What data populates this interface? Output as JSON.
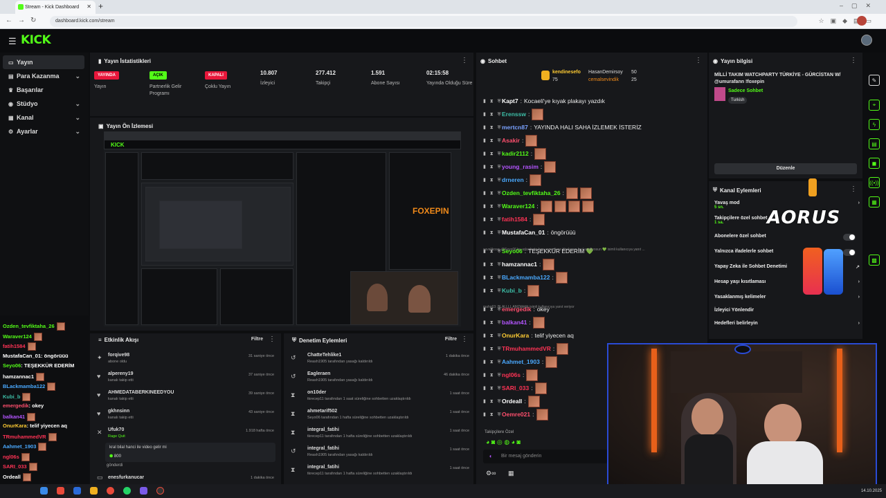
{
  "browser": {
    "tab_title": "Stream - Kick Dashboard",
    "url": "dashboard.kick.com/stream"
  },
  "header": {
    "logo": "KICK"
  },
  "sidebar": {
    "items": [
      {
        "label": "Yayın",
        "icon": "broadcast-icon",
        "active": true
      },
      {
        "label": "Para Kazanma",
        "icon": "money-icon",
        "chevron": true
      },
      {
        "label": "Başarılar",
        "icon": "trophy-icon"
      },
      {
        "label": "Stüdyo",
        "icon": "studio-icon",
        "chevron": true
      },
      {
        "label": "Kanal",
        "icon": "channel-icon",
        "chevron": true
      },
      {
        "label": "Ayarlar",
        "icon": "gear-icon",
        "chevron": true
      }
    ]
  },
  "stats": {
    "title": "Yayın İstatistikleri",
    "items": [
      {
        "value": "YAYINDA",
        "label": "Yayın",
        "kind": "badge-red"
      },
      {
        "value": "AÇIK",
        "label": "Partnerlik Gelir Programı",
        "kind": "badge-green"
      },
      {
        "value": "KAPALI",
        "label": "Çoklu Yayın",
        "kind": "badge-red"
      },
      {
        "value": "10.807",
        "label": "İzleyici"
      },
      {
        "value": "277.412",
        "label": "Takipçi"
      },
      {
        "value": "1.591",
        "label": "Abone Sayısı"
      },
      {
        "value": "02:15:58",
        "label": "Yayında Olduğu Süre"
      }
    ]
  },
  "preview": {
    "title": "Yayın Ön İzlemesi"
  },
  "activity": {
    "title": "Etkinlik Akışı",
    "filter": "Filtre",
    "items": [
      {
        "name": "forqive98",
        "sub": "abone oldu",
        "time": "31 saniye önce",
        "icon": "star-icon"
      },
      {
        "name": "alpereny19",
        "sub": "kanalı takip etti",
        "time": "37 saniye önce",
        "icon": "heart-icon"
      },
      {
        "name": "AHMEDATABERKINEEDYOU",
        "sub": "kanalı takip etti",
        "time": "39 saniye önce",
        "icon": "heart-icon"
      },
      {
        "name": "gkhnsinn",
        "sub": "kanalı takip etti",
        "time": "43 saniye önce",
        "icon": "heart-icon"
      },
      {
        "name": "Ufuk70",
        "sub": "Rage Quit",
        "time": "1.918 hafta önce",
        "icon": "close-icon"
      }
    ],
    "gift_text": "kral bilal hanci ile video gelir mi",
    "gift_amount": "800",
    "gift_sent": "gönderdi",
    "last_name": "enesfurkanucar",
    "last_time": "1 dakika önce"
  },
  "moderation": {
    "title": "Denetim Eylemleri",
    "filter": "Filtre",
    "items": [
      {
        "name": "ChatteTehlike1",
        "sub": "Reash1905 tarafından yasağı kaldırıldı",
        "time": "1 dakika önce",
        "icon": "undo-icon"
      },
      {
        "name": "Eagleraen",
        "sub": "Reash1905 tarafından yasağı kaldırıldı",
        "time": "46 dakika önce",
        "icon": "undo-icon"
      },
      {
        "name": "on10der",
        "sub": "tkrecep11 tarafından 1 saat süreliğine sohbetten uzaklaştırıldı",
        "time": "1 saat önce",
        "icon": "hourglass-icon"
      },
      {
        "name": "ahmetarif502",
        "sub": "Seyo06 tarafından 1 hafta süreliğine sohbetten uzaklaştırıldı",
        "time": "1 saat önce",
        "icon": "hourglass-icon"
      },
      {
        "name": "integral_fatihi",
        "sub": "tkrecep11 tarafından 1 hafta süreliğine sohbetten uzaklaştırıldı",
        "time": "1 saat önce",
        "icon": "hourglass-icon"
      },
      {
        "name": "integral_fatihi",
        "sub": "Reash1905 tarafından yasağı kaldırıldı",
        "time": "1 saat önce",
        "icon": "undo-icon"
      },
      {
        "name": "integral_fatihi",
        "sub": "tkrecep11 tarafından 1 hafta süreliğine sohbetten uzaklaştırıldı",
        "time": "1 saat önce",
        "icon": "hourglass-icon"
      }
    ]
  },
  "chat": {
    "title": "Sohbet",
    "pinned": [
      {
        "name": "kendinesefo",
        "amount": "75"
      },
      {
        "name": "HasanDemirsoy",
        "amount": "50"
      },
      {
        "name": "cemalsevindik",
        "amount": "25"
      }
    ],
    "messages": [
      {
        "user": "Kapt7",
        "color": "#ffffff",
        "text": "Kocaeli'ye kıyak plakayı yazdık",
        "emotes": 0
      },
      {
        "user": "Erenssw",
        "color": "#3dbfa8",
        "text": "",
        "emotes": 1
      },
      {
        "user": "mertcn87",
        "color": "#7aa2ff",
        "text": "YAYINDA HALI SAHA İZLEMEK İSTERİZ",
        "emotes": 0
      },
      {
        "user": "Asakir",
        "color": "#ff4f6d",
        "text": "",
        "emotes": 1
      },
      {
        "user": "kadir2112",
        "color": "#53fc18",
        "text": "",
        "emotes": 1
      },
      {
        "user": "young_rasim",
        "color": "#b455ff",
        "text": "",
        "emotes": 1
      },
      {
        "user": "drneren",
        "color": "#4aa9ff",
        "text": "",
        "emotes": 1
      },
      {
        "user": "Ozden_tevfiktaha_26",
        "color": "#53fc18",
        "text": "",
        "emotes": 2
      },
      {
        "user": "Waraver124",
        "color": "#53fc18",
        "text": "",
        "emotes": 4
      },
      {
        "user": "fatih1584",
        "color": "#ff3355",
        "text": "",
        "emotes": 1
      },
      {
        "user": "MustafaCan_01",
        "color": "#ffffff",
        "text": "öngörüüü",
        "emotes": 0
      },
      {
        "user": "Seyo06",
        "color": "#53fc18",
        "text": "TEŞEKKÜR EDERİM 💚",
        "emotes": 0
      },
      {
        "user": "hamzannac1",
        "color": "#ffffff",
        "text": "",
        "emotes": 1
      },
      {
        "user": "BLackmamba122",
        "color": "#4aa9ff",
        "text": "",
        "emotes": 1
      },
      {
        "user": "Kubi_b",
        "color": "#3dbfa8",
        "text": "",
        "emotes": 1
      },
      {
        "user": "emergedik",
        "color": "#ff4f6d",
        "text": "okey",
        "emotes": 0
      },
      {
        "user": "balkan41",
        "color": "#b455ff",
        "text": "",
        "emotes": 1
      },
      {
        "user": "OnurKara",
        "color": "#ffcc33",
        "text": "telif yiyecen aq",
        "emotes": 0
      },
      {
        "user": "TRmuhammedVR",
        "color": "#ff3355",
        "text": "",
        "emotes": 1
      },
      {
        "user": "Aahmet_1903",
        "color": "#4aa9ff",
        "text": "",
        "emotes": 1
      },
      {
        "user": "ngl06s",
        "color": "#ff3355",
        "text": "",
        "emotes": 1
      },
      {
        "user": "SARI_033",
        "color": "#ff3355",
        "text": "",
        "emotes": 1
      },
      {
        "user": "Ordeall",
        "color": "#ffffff",
        "text": "",
        "emotes": 1
      },
      {
        "user": "Oemre021",
        "color": "#ff4f6d",
        "text": "",
        "emotes": 1
      }
    ],
    "sys1": "yuvalikoss: @Seyo06 bu arkadaşta ban yemediyse bbakaran kral seviliyosun 💚 isimli kullanıcıya yanıt ...",
    "sys2": "maho63: BLALLLL AMZ🎟🎟 isimli kullanıcıya yanıt veriyor",
    "followers_only": "Takipçilere Özel",
    "input_placeholder": "Bir mesaj gönderin"
  },
  "stream_info": {
    "title": "Yayın bilgisi",
    "stream_title": "MİLLİ TAKIM WATCHPARTY TÜRKİYE - GÜRCİSTAN W/ @umurafann !foxepin",
    "category": "Sadece Sohbet",
    "tag": "Turkish",
    "edit": "Düzenle"
  },
  "channel_actions": {
    "title": "Kanal Eylemleri",
    "rows": [
      {
        "label": "Yavaş mod",
        "sub": "5 sn.",
        "kind": "chevron"
      },
      {
        "label": "Takipçilere özel sohbet",
        "sub": "1 sa.",
        "kind": "chevron"
      },
      {
        "label": "Abonelere özel sohbet",
        "kind": "toggle"
      },
      {
        "label": "Yalnızca ifadelerle sohbet",
        "kind": "toggle"
      },
      {
        "label": "Yapay Zeka ile Sohbet Denetimi",
        "kind": "link"
      },
      {
        "label": "Hesap yaşı kısıtlaması",
        "kind": "chevron"
      },
      {
        "label": "Yasaklanmış kelimeler",
        "kind": "chevron"
      },
      {
        "label": "İzleyici Yönlendir",
        "kind": "none"
      },
      {
        "label": "Hedefleri belirleyin",
        "kind": "chevron"
      }
    ]
  },
  "overlay": {
    "brand": "AORUS",
    "lines": [
      {
        "user": "Ozden_tevfiktaha_26",
        "color": "#53fc18",
        "text": ""
      },
      {
        "user": "Waraver124",
        "color": "#53fc18",
        "text": ""
      },
      {
        "user": "fatih1584",
        "color": "#ff3355",
        "text": ""
      },
      {
        "user": "MustafaCan_01",
        "color": "#ffffff",
        "text": ": öngörüüü"
      },
      {
        "user": "Seyo06",
        "color": "#53fc18",
        "text": ": TEŞEKKÜR EDERİM"
      },
      {
        "user": "hamzannac1",
        "color": "#ffffff",
        "text": ""
      },
      {
        "user": "BLackmamba122",
        "color": "#4aa9ff",
        "text": ""
      },
      {
        "user": "Kubi_b",
        "color": "#3dbfa8",
        "text": ""
      },
      {
        "user": "emergedik",
        "color": "#ff4f6d",
        "text": ": okey"
      },
      {
        "user": "balkan41",
        "color": "#b455ff",
        "text": ""
      },
      {
        "user": "OnurKara",
        "color": "#ffcc33",
        "text": ": telif yiyecen aq"
      },
      {
        "user": "TRmuhammedVR",
        "color": "#ff3355",
        "text": ""
      },
      {
        "user": "Aahmet_1903",
        "color": "#4aa9ff",
        "text": ""
      },
      {
        "user": "ngl06s",
        "color": "#ff3355",
        "text": ""
      },
      {
        "user": "SARI_033",
        "color": "#ff3355",
        "text": ""
      },
      {
        "user": "Ordeall",
        "color": "#ffffff",
        "text": ""
      }
    ]
  },
  "taskbar": {
    "date": "14.10.2025"
  },
  "colors": {
    "accent": "#53fc18",
    "live": "#e8173b",
    "panel": "#17181b",
    "webcam_border": "#2a4bd6"
  }
}
